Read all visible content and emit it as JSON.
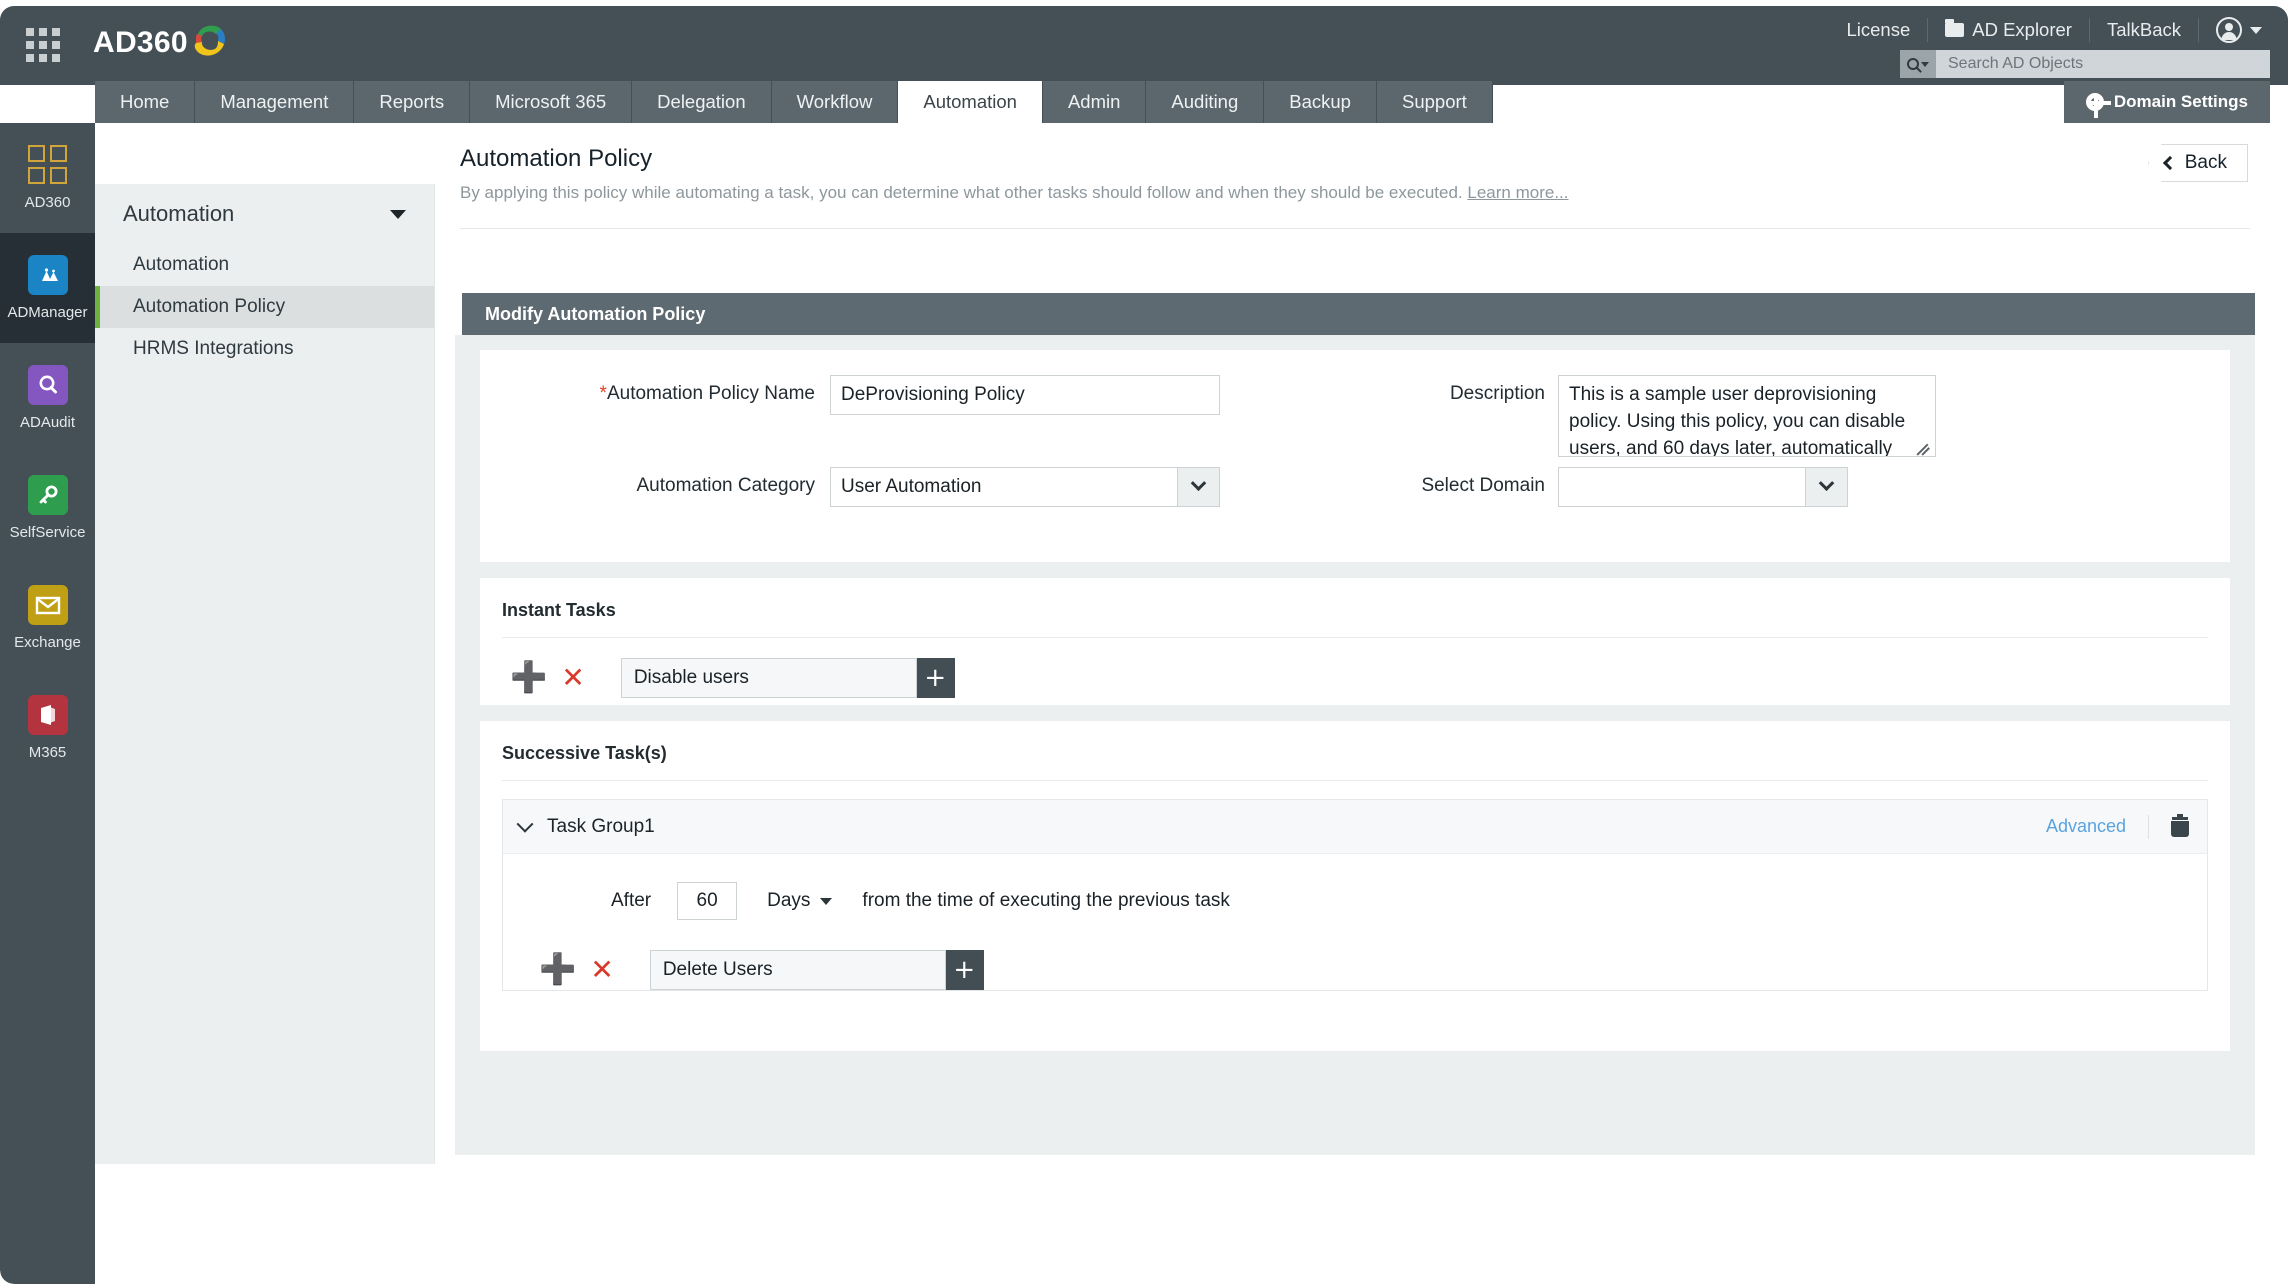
{
  "header": {
    "brand": "AD360",
    "waffle_icon": "apps-grid-icon",
    "links": [
      {
        "label": "License",
        "icon": null
      },
      {
        "label": "AD Explorer",
        "icon": "folder-icon"
      },
      {
        "label": "TalkBack",
        "icon": null
      }
    ],
    "account_icon": "user-account-icon",
    "search": {
      "placeholder": "Search AD Objects",
      "value": "",
      "icon": "search-icon"
    },
    "domain_settings": {
      "label": "Domain Settings",
      "icon": "gear-icon"
    }
  },
  "tabs": [
    {
      "label": "Home",
      "active": false
    },
    {
      "label": "Management",
      "active": false
    },
    {
      "label": "Reports",
      "active": false
    },
    {
      "label": "Microsoft 365",
      "active": false
    },
    {
      "label": "Delegation",
      "active": false
    },
    {
      "label": "Workflow",
      "active": false
    },
    {
      "label": "Automation",
      "active": true
    },
    {
      "label": "Admin",
      "active": false
    },
    {
      "label": "Auditing",
      "active": false
    },
    {
      "label": "Backup",
      "active": false
    },
    {
      "label": "Support",
      "active": false
    }
  ],
  "product_rail": [
    {
      "label": "AD360",
      "icon": "ad360-squares-icon",
      "active": false,
      "color": "#d2a53c"
    },
    {
      "label": "ADManager",
      "icon": "admanager-icon",
      "active": true,
      "color": "#1b84c4"
    },
    {
      "label": "ADAudit",
      "icon": "adaudit-magnifier-icon",
      "active": false,
      "color": "#8456c0"
    },
    {
      "label": "SelfService",
      "icon": "selfservice-key-icon",
      "active": false,
      "color": "#2e9e4e"
    },
    {
      "label": "Exchange",
      "icon": "exchange-envelope-icon",
      "active": false,
      "color": "#bfa015"
    },
    {
      "label": "M365",
      "icon": "m365-office-icon",
      "active": false,
      "color": "#b3333f"
    }
  ],
  "subnav": {
    "header": "Automation",
    "caret_icon": "chevron-down-icon",
    "items": [
      {
        "label": "Automation",
        "active": false
      },
      {
        "label": "Automation Policy",
        "active": true
      },
      {
        "label": "HRMS Integrations",
        "active": false
      }
    ]
  },
  "page": {
    "title": "Automation Policy",
    "subtitle": "By applying this policy while automating a task, you can determine what other tasks should follow and when they should be executed.",
    "learn_more": "Learn more...",
    "back_button": {
      "label": "Back",
      "icon": "chevron-left-icon"
    }
  },
  "card": {
    "header": "Modify Automation Policy",
    "fields": {
      "policy_name": {
        "label": "Automation Policy Name",
        "required_marker": "*",
        "value": "DeProvisioning Policy"
      },
      "description": {
        "label": "Description",
        "value": "This is a sample user deprovisioning policy. Using this policy, you can disable users, and 60 days later, automatically",
        "resize_handle_icon": "resize-grip-icon"
      },
      "automation_category": {
        "label": "Automation Category",
        "value": "User Automation",
        "caret_icon": "chevron-down-icon"
      },
      "select_domain": {
        "label": "Select Domain",
        "value": "",
        "caret_icon": "chevron-down-icon"
      }
    },
    "instant_tasks": {
      "title": "Instant Tasks",
      "rows": [
        {
          "add_icon": "plus-green-icon",
          "remove_icon": "x-red-icon",
          "task": "Disable users",
          "append_icon": "plus-icon"
        }
      ]
    },
    "successive_tasks": {
      "title": "Successive Task(s)",
      "groups": [
        {
          "name": "Task Group1",
          "collapse_icon": "chevron-down-icon",
          "advanced_label": "Advanced",
          "delete_icon": "trash-icon",
          "schedule": {
            "after_label": "After",
            "amount": "60",
            "unit": "Days",
            "unit_caret_icon": "chevron-down-icon",
            "note": "from the time of executing the previous task"
          },
          "rows": [
            {
              "add_icon": "plus-green-icon",
              "remove_icon": "x-red-icon",
              "task": "Delete Users",
              "append_icon": "plus-icon"
            }
          ]
        }
      ]
    }
  },
  "colors": {
    "header_bg": "#455056",
    "tab_bg": "#5c676d",
    "accent_green": "#6cb33f",
    "link_blue": "#5ba3de",
    "required_red": "#e0402a",
    "card_header_bg": "#5e6a71"
  }
}
